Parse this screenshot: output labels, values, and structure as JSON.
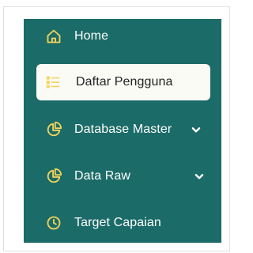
{
  "colors": {
    "sidebar_bg": "#1b6b68",
    "icon_accent": "#f3d35a",
    "active_bg": "#fbfbf6",
    "active_text": "#222222",
    "text": "#ffffff"
  },
  "sidebar": {
    "items": [
      {
        "label": "Home",
        "icon": "home-icon",
        "active": false,
        "has_dropdown": false
      },
      {
        "label": "Daftar Pengguna",
        "icon": "list-icon",
        "active": true,
        "has_dropdown": false
      },
      {
        "label": "Database Master",
        "icon": "pie-chart-icon",
        "active": false,
        "has_dropdown": true
      },
      {
        "label": "Data Raw",
        "icon": "pie-chart-icon",
        "active": false,
        "has_dropdown": true
      },
      {
        "label": "Target Capaian",
        "icon": "clock-icon",
        "active": false,
        "has_dropdown": false
      }
    ]
  }
}
